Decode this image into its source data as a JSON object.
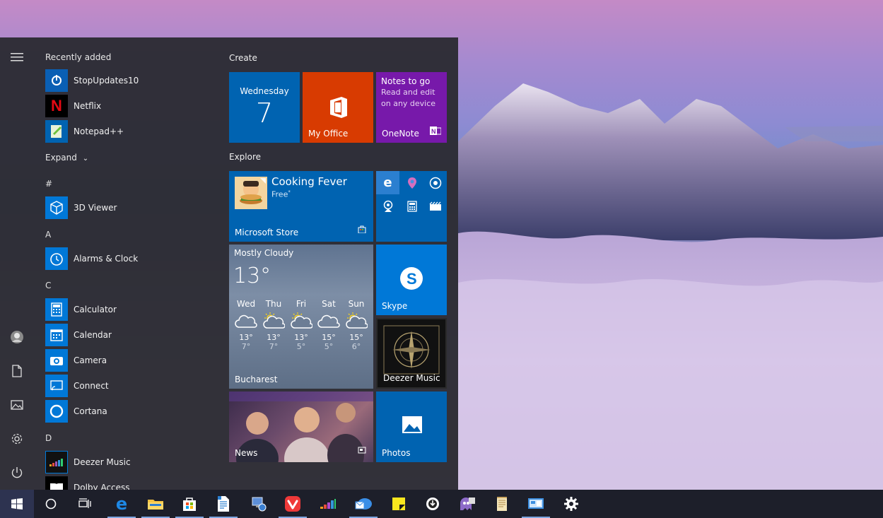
{
  "start_menu": {
    "recently_added_label": "Recently added",
    "recent_apps": [
      {
        "label": "StopUpdates10",
        "icon": "stopupdates-icon"
      },
      {
        "label": "Netflix",
        "icon": "netflix-icon"
      },
      {
        "label": "Notepad++",
        "icon": "notepadpp-icon"
      }
    ],
    "expand_label": "Expand",
    "sections": [
      {
        "letter": "#",
        "apps": [
          {
            "label": "3D Viewer",
            "icon": "cube-icon"
          }
        ]
      },
      {
        "letter": "A",
        "apps": [
          {
            "label": "Alarms & Clock",
            "icon": "clock-icon"
          }
        ]
      },
      {
        "letter": "C",
        "apps": [
          {
            "label": "Calculator",
            "icon": "calculator-icon"
          },
          {
            "label": "Calendar",
            "icon": "calendar-icon"
          },
          {
            "label": "Camera",
            "icon": "camera-icon"
          },
          {
            "label": "Connect",
            "icon": "connect-icon"
          },
          {
            "label": "Cortana",
            "icon": "cortana-icon"
          }
        ]
      },
      {
        "letter": "D",
        "apps": [
          {
            "label": "Deezer Music",
            "icon": "deezer-icon"
          },
          {
            "label": "Dolby Access",
            "icon": "dolby-icon"
          }
        ]
      }
    ],
    "tile_groups": [
      {
        "title": "Create"
      },
      {
        "title": "Explore"
      }
    ],
    "tiles": {
      "calendar": {
        "day": "Wednesday",
        "date": "7"
      },
      "office": {
        "label": "My Office"
      },
      "onenote": {
        "title": "Notes to go",
        "subtitle_line1": "Read and edit",
        "subtitle_line2": "on any device",
        "label": "OneNote"
      },
      "store": {
        "app": "Cooking Fever",
        "price": "Free",
        "price_mark": "*",
        "label": "Microsoft Store"
      },
      "weather": {
        "condition": "Mostly Cloudy",
        "temp": "13°",
        "city": "Bucharest",
        "days": [
          {
            "day": "Wed",
            "high": "13°",
            "low": "7°",
            "icon": "cloudy-icon"
          },
          {
            "day": "Thu",
            "high": "13°",
            "low": "7°",
            "icon": "partly-sunny-icon"
          },
          {
            "day": "Fri",
            "high": "13°",
            "low": "5°",
            "icon": "partly-sunny-icon"
          },
          {
            "day": "Sat",
            "high": "15°",
            "low": "5°",
            "icon": "cloudy-icon"
          },
          {
            "day": "Sun",
            "high": "15°",
            "low": "6°",
            "icon": "partly-sunny-icon"
          }
        ]
      },
      "skype": {
        "label": "Skype"
      },
      "deezer": {
        "label": "Deezer Music"
      },
      "news": {
        "label": "News"
      },
      "photos": {
        "label": "Photos"
      }
    }
  },
  "taskbar": {
    "items": [
      {
        "name": "start-button",
        "icon": "windows-logo-icon"
      },
      {
        "name": "cortana-search",
        "icon": "circle-icon"
      },
      {
        "name": "task-view",
        "icon": "task-view-icon"
      },
      {
        "name": "edge",
        "icon": "edge-icon"
      },
      {
        "name": "file-explorer",
        "icon": "folder-icon"
      },
      {
        "name": "store",
        "icon": "store-bag-icon"
      },
      {
        "name": "wordpad",
        "icon": "document-icon"
      },
      {
        "name": "network-app",
        "icon": "network-icon"
      },
      {
        "name": "vivaldi",
        "icon": "vivaldi-icon"
      },
      {
        "name": "deezer",
        "icon": "deezer-bars-icon"
      },
      {
        "name": "mail",
        "icon": "mail-cloud-icon"
      },
      {
        "name": "sticky-notes",
        "icon": "sticky-note-icon"
      },
      {
        "name": "app-circle",
        "icon": "circle-arrow-icon"
      },
      {
        "name": "ghost-app",
        "icon": "ghost-icon"
      },
      {
        "name": "notepad-app",
        "icon": "notepad-icon"
      },
      {
        "name": "remote-desktop",
        "icon": "remote-desktop-icon"
      },
      {
        "name": "settings",
        "icon": "gear-icon"
      }
    ]
  },
  "colors": {
    "accent": "#0063b1",
    "office": "#d83b01",
    "onenote": "#7719aa",
    "skype": "#0078d7",
    "menu_bg": "#2c2c34",
    "taskbar_bg": "#1d1f2a"
  }
}
